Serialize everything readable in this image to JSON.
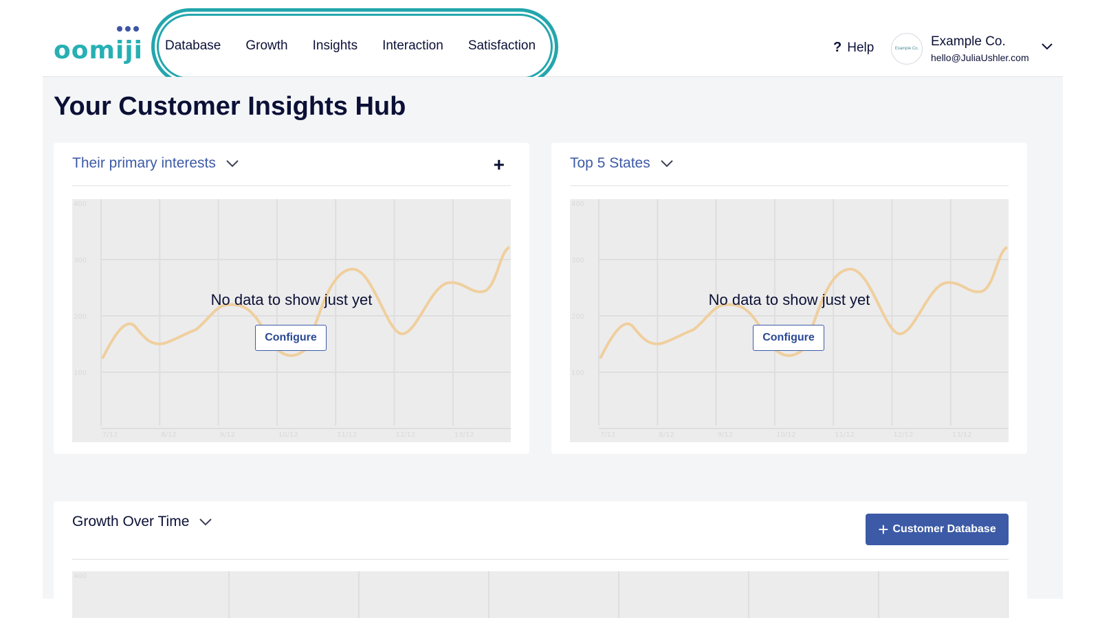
{
  "header": {
    "logo": "oomiji",
    "nav": [
      "Database",
      "Growth",
      "Insights",
      "Interaction",
      "Satisfaction"
    ],
    "help_label": "Help",
    "help_icon": "question-icon",
    "avatar_text": "Example Co.",
    "company_name": "Example Co.",
    "company_email": "hello@JuliaUshler.com",
    "highlight_color": "#23a6ad"
  },
  "main": {
    "title": "Your Customer Insights Hub",
    "cards": [
      {
        "title": "Their primary interests",
        "empty_text": "No data to show just yet",
        "configure_label": "Configure",
        "add_icon": "plus-icon"
      },
      {
        "title": "Top 5 States",
        "empty_text": "No data to show just yet",
        "configure_label": "Configure"
      }
    ],
    "growth": {
      "title": "Growth Over Time",
      "button_label": "Customer Database",
      "button_icon": "plus-icon",
      "y_tick_top": "400"
    }
  },
  "placeholder_chart": {
    "y_ticks": [
      "400",
      "300",
      "200",
      "100"
    ],
    "x_ticks": [
      "7/12",
      "8/12",
      "9/12",
      "10/12",
      "11/12",
      "12/12",
      "13/12"
    ],
    "line_color": "#f0cf9e"
  },
  "colors": {
    "brand": "#27b0b3",
    "accent": "#3c5aa6",
    "text": "#0b1036"
  }
}
